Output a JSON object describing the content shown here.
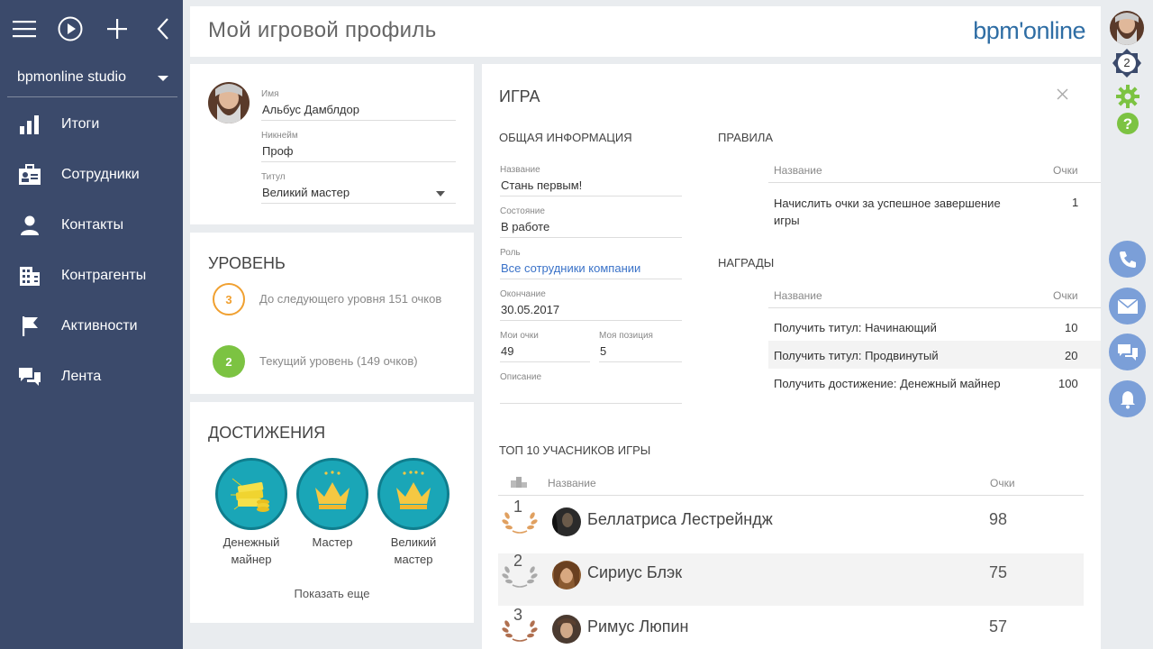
{
  "sidebar": {
    "workspace": "bpmonline studio",
    "items": [
      {
        "label": "Итоги",
        "icon": "bar-chart-icon"
      },
      {
        "label": "Сотрудники",
        "icon": "employee-card-icon"
      },
      {
        "label": "Контакты",
        "icon": "person-icon"
      },
      {
        "label": "Контрагенты",
        "icon": "building-icon"
      },
      {
        "label": "Активности",
        "icon": "flag-icon"
      },
      {
        "label": "Лента",
        "icon": "chat-bubbles-icon"
      }
    ]
  },
  "header": {
    "title": "Мой игровой профиль",
    "logo": "bpm'online"
  },
  "profile": {
    "name_label": "Имя",
    "name": "Альбус Дамблдор",
    "nick_label": "Никнейм",
    "nick": "Проф",
    "title_label": "Титул",
    "title": "Великий мастер"
  },
  "level": {
    "heading": "УРОВЕНЬ",
    "next_num": "3",
    "next_text": "До следующего уровня 151 очков",
    "cur_num": "2",
    "cur_text": "Текущий уровень (149 очков)"
  },
  "achievements": {
    "heading": "ДОСТИЖЕНИЯ",
    "items": [
      {
        "line1": "Денежный",
        "line2": "майнер",
        "icon": "money-stack-icon"
      },
      {
        "line1": "Мастер",
        "line2": "",
        "icon": "crown-icon"
      },
      {
        "line1": "Великий",
        "line2": "мастер",
        "icon": "crown-icon"
      }
    ],
    "show_more": "Показать еще"
  },
  "game": {
    "heading": "ИГРА",
    "general_heading": "ОБЩАЯ ИНФОРМАЦИЯ",
    "fields": {
      "name_label": "Название",
      "name": "Стань первым!",
      "state_label": "Состояние",
      "state": "В работе",
      "role_label": "Роль",
      "role": "Все сотрудники компании",
      "end_label": "Окончание",
      "end": "30.05.2017",
      "my_points_label": "Мои очки",
      "my_points": "49",
      "my_pos_label": "Моя позиция",
      "my_pos": "5",
      "desc_label": "Описание"
    },
    "rules": {
      "heading": "ПРАВИЛА",
      "col_name": "Название",
      "col_points": "Очки",
      "rows": [
        {
          "name_l1": "Начислить очки за успешное завершение",
          "name_l2": "игры",
          "points": "1"
        }
      ]
    },
    "rewards": {
      "heading": "НАГРАДЫ",
      "col_name": "Название",
      "col_points": "Очки",
      "rows": [
        {
          "name": "Получить титул: Начинающий",
          "points": "10"
        },
        {
          "name": "Получить титул: Продвинутый",
          "points": "20"
        },
        {
          "name": "Получить достижение: Денежный майнер",
          "points": "100"
        }
      ]
    },
    "top": {
      "heading": "ТОП 10 УЧАСНИКОВ ИГРЫ",
      "col_name": "Название",
      "col_points": "Очки",
      "rows": [
        {
          "rank": "1",
          "name": "Беллатриса Лестрейндж",
          "points": "98",
          "laurel_color": "#e0a060"
        },
        {
          "rank": "2",
          "name": "Сириус Блэк",
          "points": "75",
          "laurel_color": "#aaaaaa"
        },
        {
          "rank": "3",
          "name": "Римус Люпин",
          "points": "57",
          "laurel_color": "#b07050"
        }
      ]
    }
  },
  "right": {
    "notifications_count": "2"
  },
  "colors": {
    "sidebar": "#3b4a6b",
    "accent": "#2e6da4",
    "level_next": "#f0a030",
    "level_cur": "#7cc342",
    "badge": "#1aa6b7",
    "action_button": "#7b9fd8"
  }
}
